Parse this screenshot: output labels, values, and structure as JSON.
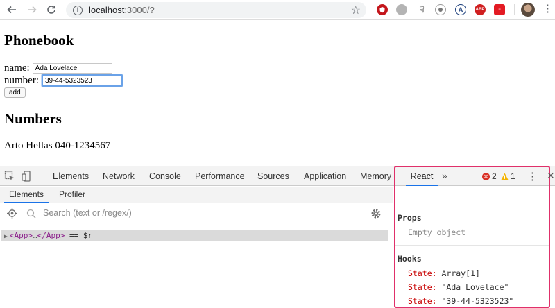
{
  "browser": {
    "url_host": "localhost",
    "url_port_path": ":3000/?",
    "extensions": [
      "ublock-icon",
      "ext-gray-icon",
      "ext-hand-icon",
      "ext-camera-icon",
      "ext-a-icon",
      "ABP",
      "ext-red-icon"
    ],
    "abp_label": "ABP"
  },
  "page": {
    "title": "Phonebook",
    "name_label": "name:",
    "name_value": "Ada Lovelace",
    "number_label": "number:",
    "number_value": "39-44-5323523",
    "add_label": "add",
    "numbers_title": "Numbers",
    "entries": [
      "Arto Hellas 040-1234567"
    ]
  },
  "devtools": {
    "tabs": [
      "Elements",
      "Network",
      "Console",
      "Performance",
      "Sources",
      "Application",
      "Memory",
      "React"
    ],
    "more": "»",
    "errors": "2",
    "warnings": "1",
    "sub_tabs": [
      "Elements",
      "Profiler"
    ],
    "search_placeholder": "Search (text or /regex/)",
    "tree_open": "<App>",
    "tree_ellipsis": "…",
    "tree_close": "</App>",
    "tree_suffix": " == $r",
    "props_title": "Props",
    "props_empty": "Empty object",
    "hooks_title": "Hooks",
    "hooks": [
      {
        "key": "State:",
        "value": "Array[1]"
      },
      {
        "key": "State:",
        "value": "\"Ada Lovelace\""
      },
      {
        "key": "State:",
        "value": "\"39-44-5323523\""
      }
    ]
  },
  "colors": {
    "highlight_border": "#e0306a",
    "active_tab": "#1a73e8",
    "hook_key": "#c80000"
  }
}
